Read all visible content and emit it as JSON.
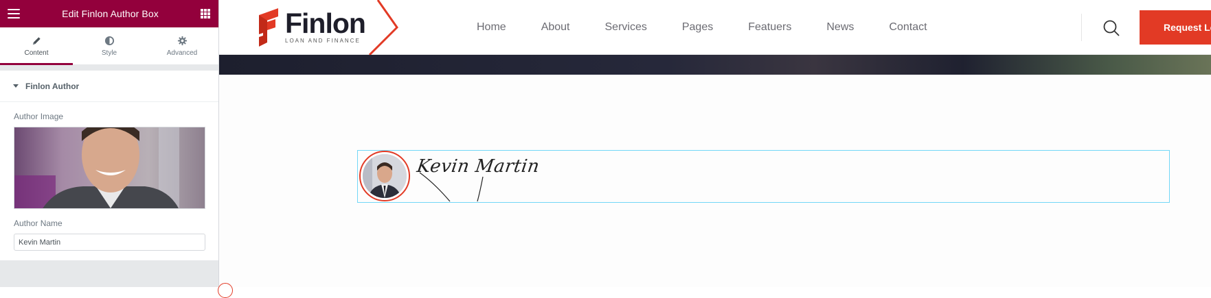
{
  "panel": {
    "title": "Edit Finlon Author Box",
    "tabs": [
      {
        "label": "Content",
        "icon": "pencil-icon",
        "active": true
      },
      {
        "label": "Style",
        "icon": "half-circle-icon",
        "active": false
      },
      {
        "label": "Advanced",
        "icon": "gear-icon",
        "active": false
      }
    ],
    "section": {
      "title": "Finlon Author",
      "image_label": "Author Image",
      "name_label": "Author Name",
      "name_value": "Kevin Martin"
    },
    "accent_color": "#93003c"
  },
  "site": {
    "logo": {
      "word": "Finlon",
      "tagline": "LOAN AND FINANCE"
    },
    "nav": [
      "Home",
      "About",
      "Services",
      "Pages",
      "Featuers",
      "News",
      "Contact"
    ],
    "cta": "Request Lo",
    "brand_color": "#e23a25"
  },
  "author_box": {
    "signature": "Kevin Martin"
  }
}
